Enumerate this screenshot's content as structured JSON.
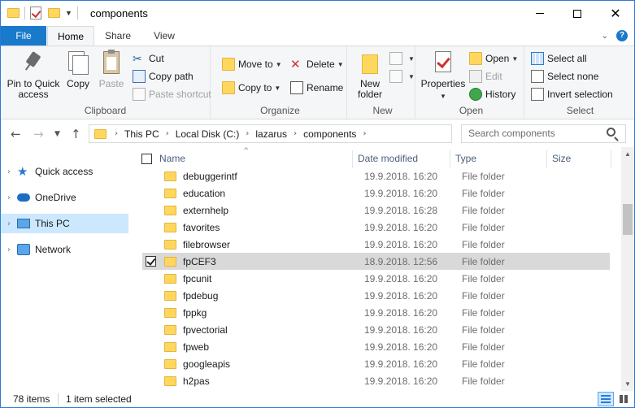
{
  "window": {
    "title": "components",
    "controls": {
      "minimize": "",
      "maximize": "",
      "close": "✕"
    }
  },
  "tabs": {
    "file": "File",
    "home": "Home",
    "share": "Share",
    "view": "View"
  },
  "ribbon": {
    "clipboard": {
      "label": "Clipboard",
      "pin_line1": "Pin to Quick",
      "pin_line2": "access",
      "copy": "Copy",
      "paste": "Paste",
      "cut": "Cut",
      "copy_path": "Copy path",
      "paste_shortcut": "Paste shortcut"
    },
    "organize": {
      "label": "Organize",
      "move_to": "Move to",
      "copy_to": "Copy to",
      "delete": "Delete",
      "rename": "Rename"
    },
    "new": {
      "label": "New",
      "new_folder_line1": "New",
      "new_folder_line2": "folder"
    },
    "open": {
      "label": "Open",
      "properties": "Properties",
      "open": "Open",
      "edit": "Edit",
      "history": "History"
    },
    "select": {
      "label": "Select",
      "select_all": "Select all",
      "select_none": "Select none",
      "invert_selection": "Invert selection"
    }
  },
  "address": {
    "breadcrumbs": [
      "This PC",
      "Local Disk (C:)",
      "lazarus",
      "components"
    ],
    "search_placeholder": "Search components"
  },
  "navpane": {
    "items": [
      {
        "label": "Quick access",
        "icon": "star-icon"
      },
      {
        "label": "OneDrive",
        "icon": "cloud-icon"
      },
      {
        "label": "This PC",
        "icon": "computer-icon",
        "selected": true
      },
      {
        "label": "Network",
        "icon": "network-icon"
      }
    ]
  },
  "filelist": {
    "columns": {
      "name": "Name",
      "date": "Date modified",
      "type": "Type",
      "size": "Size"
    },
    "rows": [
      {
        "name": "debuggerintf",
        "date": "19.9.2018. 16:20",
        "type": "File folder"
      },
      {
        "name": "education",
        "date": "19.9.2018. 16:20",
        "type": "File folder"
      },
      {
        "name": "externhelp",
        "date": "19.9.2018. 16:28",
        "type": "File folder"
      },
      {
        "name": "favorites",
        "date": "19.9.2018. 16:20",
        "type": "File folder"
      },
      {
        "name": "filebrowser",
        "date": "19.9.2018. 16:20",
        "type": "File folder"
      },
      {
        "name": "fpCEF3",
        "date": "18.9.2018. 12:56",
        "type": "File folder",
        "selected": true
      },
      {
        "name": "fpcunit",
        "date": "19.9.2018. 16:20",
        "type": "File folder"
      },
      {
        "name": "fpdebug",
        "date": "19.9.2018. 16:20",
        "type": "File folder"
      },
      {
        "name": "fppkg",
        "date": "19.9.2018. 16:20",
        "type": "File folder"
      },
      {
        "name": "fpvectorial",
        "date": "19.9.2018. 16:20",
        "type": "File folder"
      },
      {
        "name": "fpweb",
        "date": "19.9.2018. 16:20",
        "type": "File folder"
      },
      {
        "name": "googleapis",
        "date": "19.9.2018. 16:20",
        "type": "File folder"
      },
      {
        "name": "h2pas",
        "date": "19.9.2018. 16:20",
        "type": "File folder"
      }
    ]
  },
  "status": {
    "item_count": "78 items",
    "selected": "1 item selected"
  },
  "colors": {
    "accent": "#1979ca",
    "selection": "#cce8ff",
    "row_selected": "#d9d9d9",
    "folder": "#ffd75e"
  }
}
